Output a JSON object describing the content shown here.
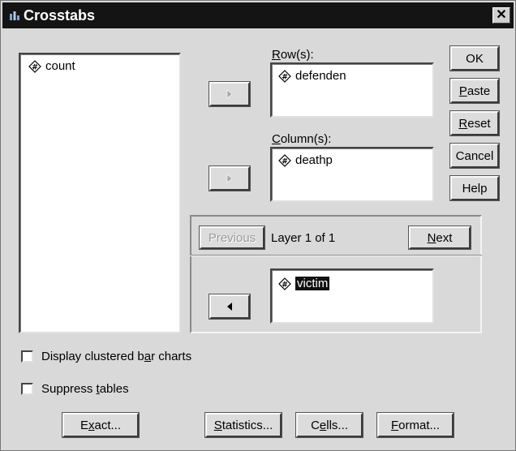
{
  "window": {
    "title": "Crosstabs",
    "close_label": "✕"
  },
  "source_list": {
    "items": [
      {
        "label": "count",
        "icon": "numeric-variable-icon"
      }
    ]
  },
  "rows": {
    "label": "Row(s):",
    "items": [
      {
        "label": "defenden",
        "icon": "numeric-variable-icon"
      }
    ]
  },
  "columns": {
    "label": "Column(s):",
    "items": [
      {
        "label": "deathp",
        "icon": "numeric-variable-icon"
      }
    ]
  },
  "layer": {
    "previous_label": "Previous",
    "status": "Layer 1 of 1",
    "next_label": "Next",
    "items": [
      {
        "label": "victim",
        "icon": "numeric-variable-icon",
        "selected": true
      }
    ]
  },
  "side_buttons": {
    "ok": "OK",
    "paste": "Paste",
    "reset": "Reset",
    "cancel": "Cancel",
    "help": "Help"
  },
  "options": {
    "clustered_bar": {
      "label": "Display clustered bar charts",
      "checked": false
    },
    "suppress_tables": {
      "label": "Suppress tables",
      "checked": false
    }
  },
  "bottom_buttons": {
    "exact": "Exact...",
    "statistics": "Statistics...",
    "cells": "Cells...",
    "format": "Format..."
  }
}
